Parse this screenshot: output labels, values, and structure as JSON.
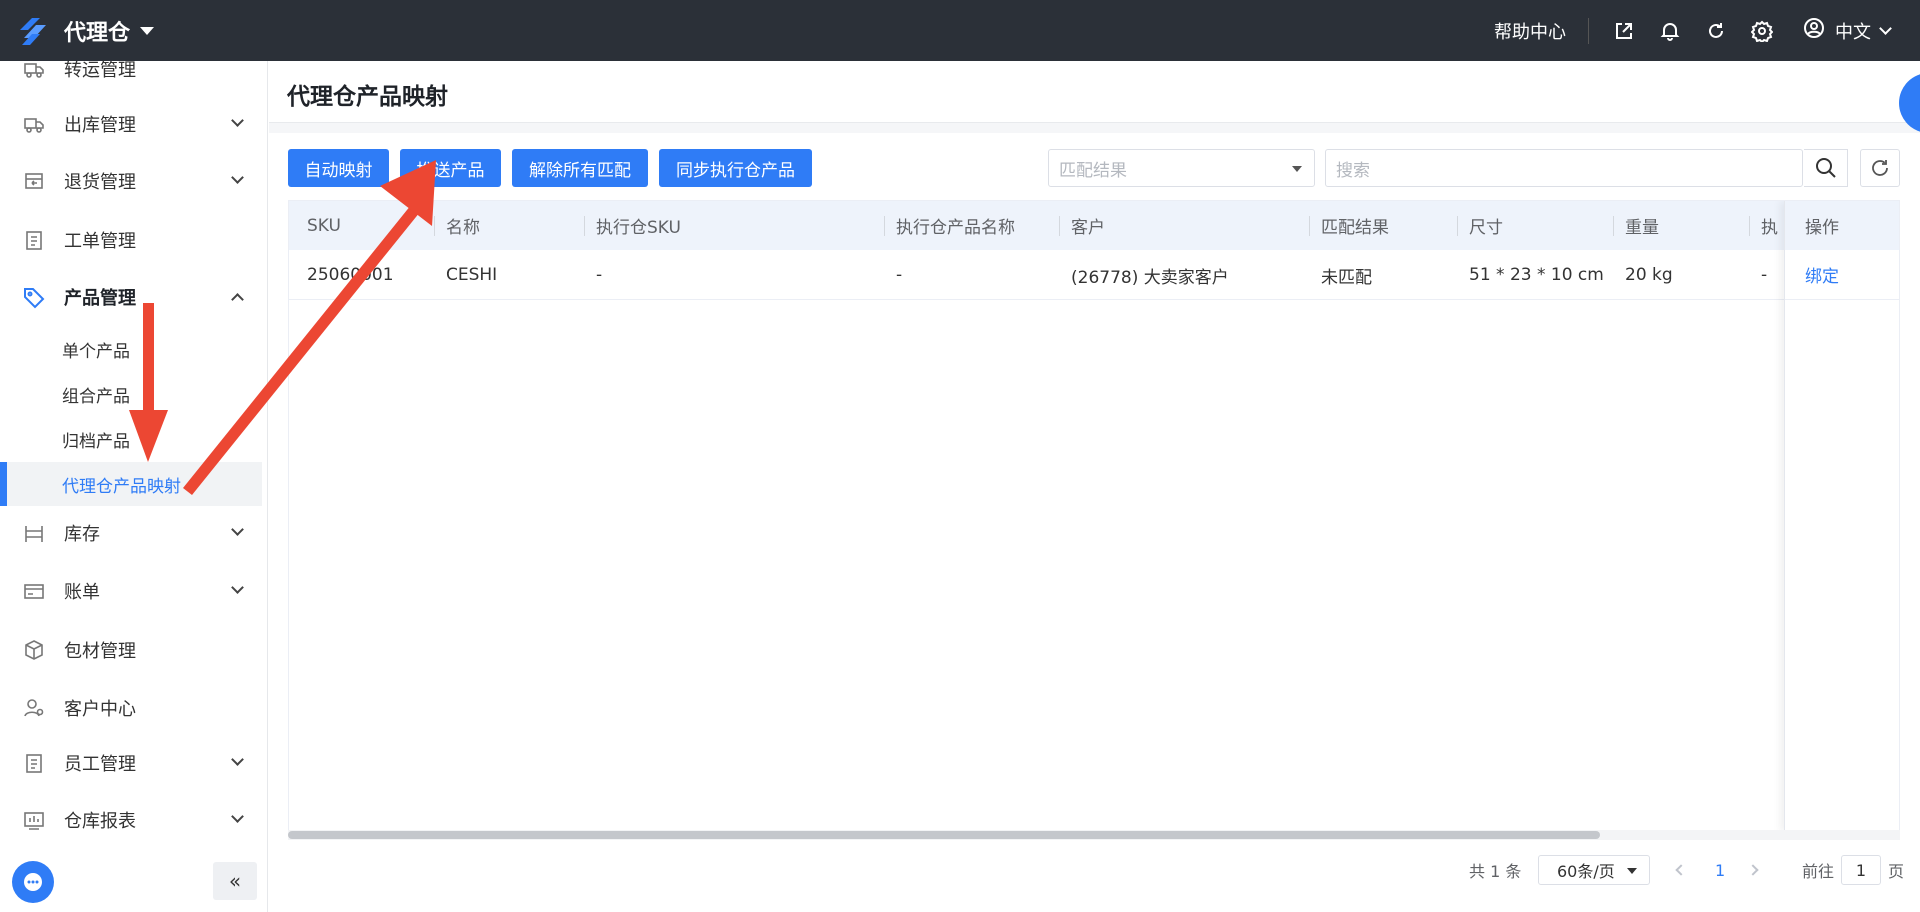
{
  "topbar": {
    "app_title": "代理仓",
    "help_label": "帮助中心",
    "language": "中文"
  },
  "sidebar": {
    "items": [
      {
        "label": "转运管理",
        "icon": "truck-transfer-icon"
      },
      {
        "label": "出库管理",
        "icon": "delivery-truck-icon"
      },
      {
        "label": "退货管理",
        "icon": "return-box-icon"
      },
      {
        "label": "工单管理",
        "icon": "clipboard-icon"
      },
      {
        "label": "产品管理",
        "icon": "tag-icon"
      },
      {
        "label": "库存",
        "icon": "warehouse-shelf-icon"
      },
      {
        "label": "账单",
        "icon": "card-icon"
      },
      {
        "label": "包材管理",
        "icon": "package-icon"
      },
      {
        "label": "客户中心",
        "icon": "customer-icon"
      },
      {
        "label": "员工管理",
        "icon": "staff-icon"
      },
      {
        "label": "仓库报表",
        "icon": "report-icon"
      }
    ],
    "sub_items": [
      {
        "label": "单个产品"
      },
      {
        "label": "组合产品"
      },
      {
        "label": "归档产品"
      },
      {
        "label": "代理仓产品映射"
      }
    ]
  },
  "page": {
    "title": "代理仓产品映射"
  },
  "toolbar": {
    "buttons": [
      {
        "label": "自动映射"
      },
      {
        "label": "推送产品"
      },
      {
        "label": "解除所有匹配"
      },
      {
        "label": "同步执行仓产品"
      }
    ],
    "match_select_placeholder": "匹配结果",
    "search_placeholder": "搜索"
  },
  "table": {
    "columns": [
      "SKU",
      "名称",
      "执行仓SKU",
      "执行仓产品名称",
      "客户",
      "匹配结果",
      "尺寸",
      "重量",
      "执",
      "操作"
    ],
    "rows": [
      {
        "sku": "25060001",
        "name": "CESHI",
        "exec_sku": "-",
        "exec_name": "-",
        "customer": "(26778) 大卖家客户",
        "match": "未匹配",
        "size": "51 * 23 * 10 cm",
        "weight": "20 kg",
        "exec_extra": "-",
        "action": "绑定"
      }
    ]
  },
  "pagination": {
    "total": "共 1 条",
    "page_size": "60条/页",
    "current_page": "1",
    "goto_label": "前往",
    "goto_value": "1",
    "page_suffix": "页"
  },
  "colors": {
    "primary": "#2f7cf6",
    "topbar": "#2b3038",
    "annotation_arrow": "#ec4733"
  }
}
